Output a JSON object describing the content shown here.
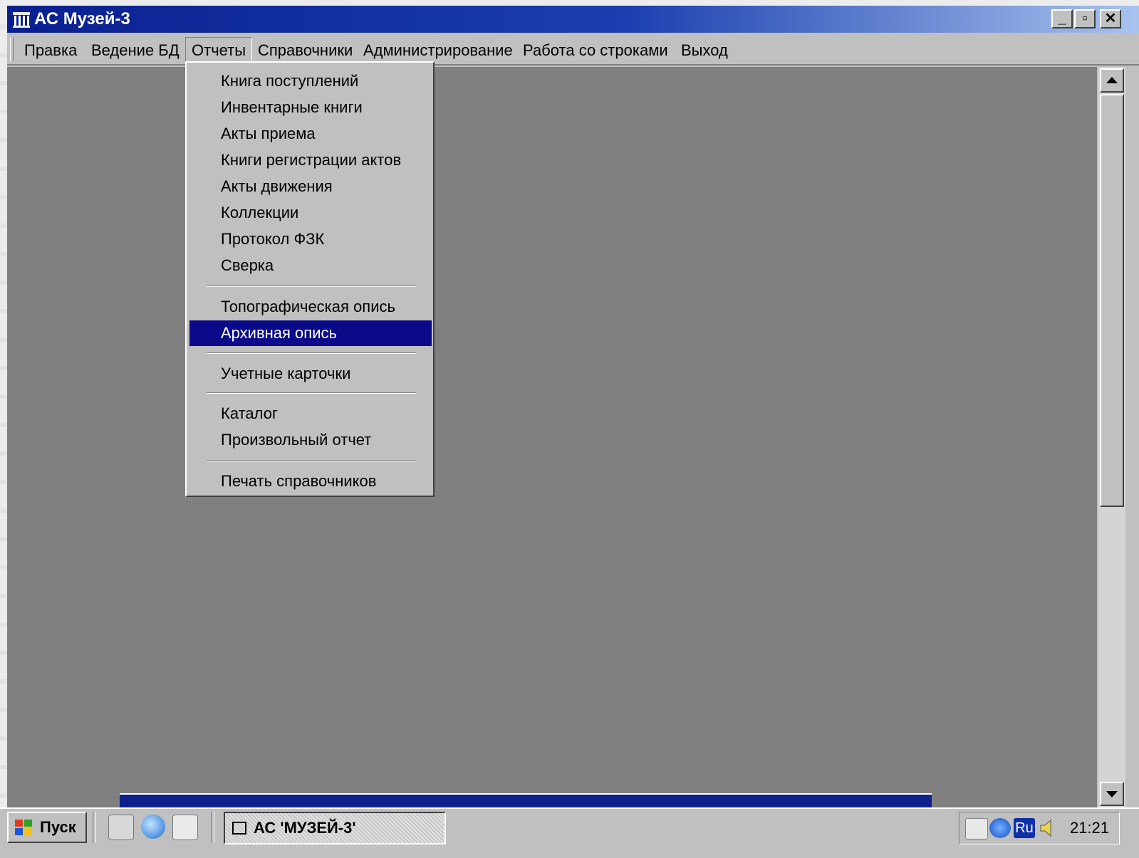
{
  "window": {
    "title": "АС Музей-3",
    "controls": {
      "minimize": "_",
      "maximize": "▫",
      "close": "✕"
    }
  },
  "menubar": {
    "items": [
      "Правка",
      "Ведение БД",
      "Отчеты",
      "Справочники",
      "Администрирование",
      "Работа со строками",
      "Выход"
    ],
    "open_index": 2
  },
  "dropdown": {
    "items": [
      "Книга поступлений",
      "Инвентарные книги",
      "Акты приема",
      "Книги регистрации актов",
      "Акты движения",
      "Коллекции",
      "Протокол ФЗК",
      "Сверка",
      "Топографическая опись",
      "Архивная опись",
      "Учетные карточки",
      "Каталог",
      "Произвольный отчет",
      "Печать справочников"
    ],
    "selected": "Архивная опись"
  },
  "taskbar": {
    "start_label": "Пуск",
    "task_label": "АС 'МУЗЕЙ-3'",
    "lang": "Ru",
    "clock": "21:21"
  },
  "colors": {
    "title_bar": "#0a1f8f",
    "highlight": "#0b0b8a",
    "mdi_background": "#808080",
    "face": "#c0c0c0"
  }
}
